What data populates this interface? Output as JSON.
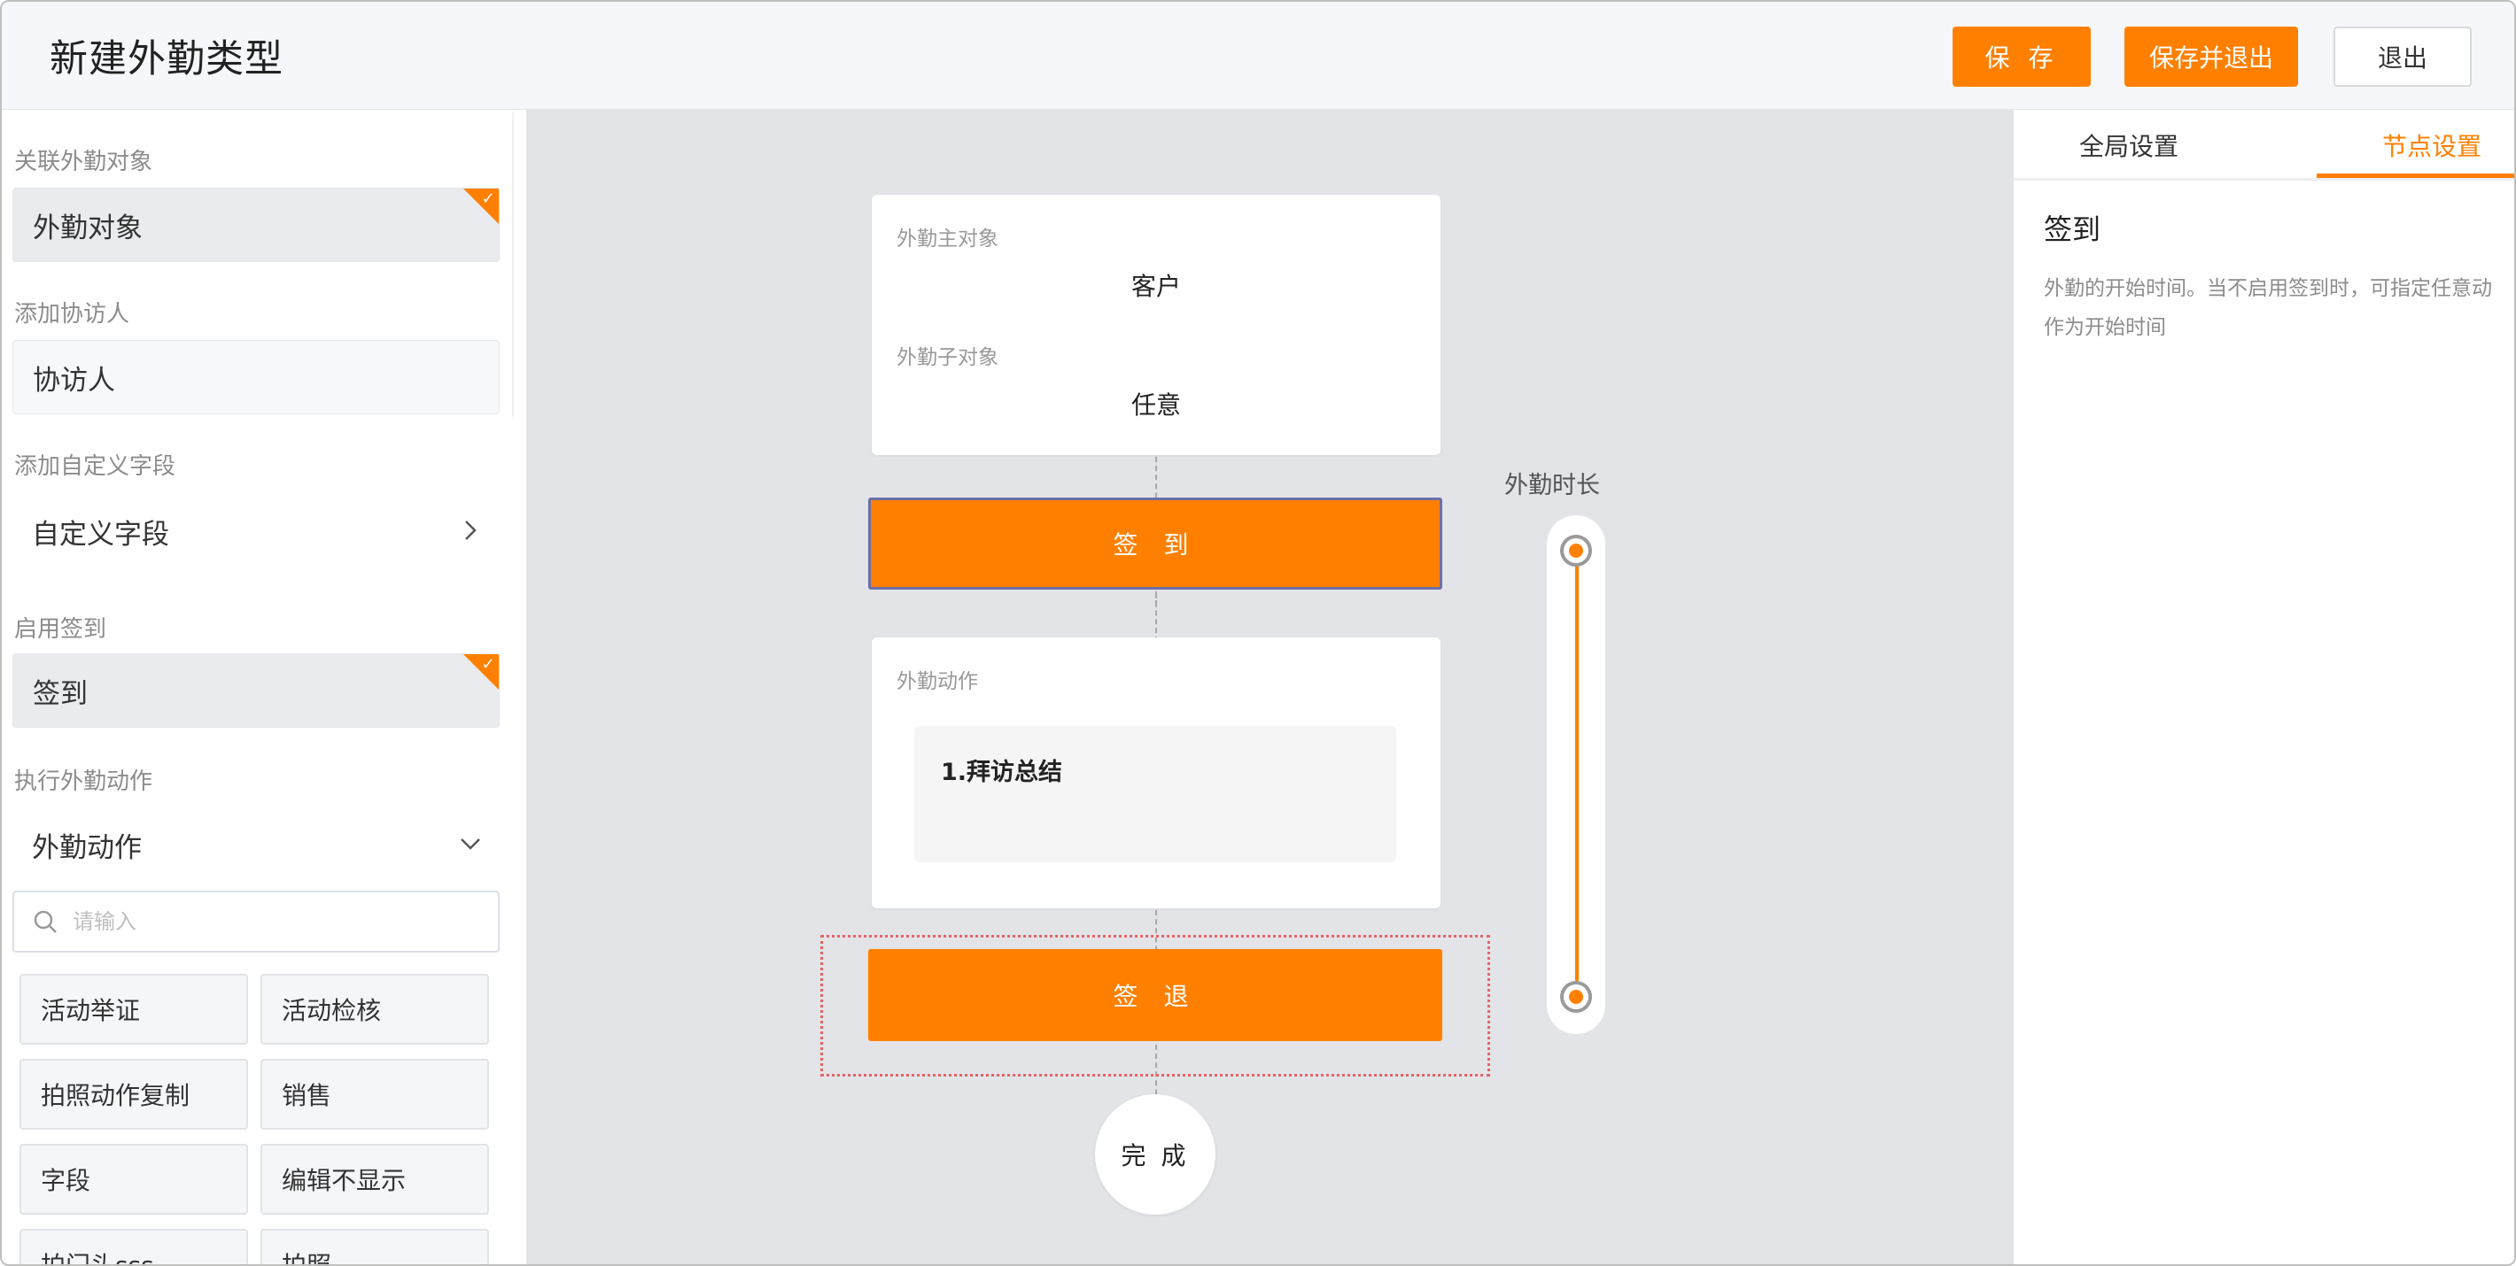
{
  "header": {
    "title": "新建外勤类型",
    "save_label": "保 存",
    "save_exit_label": "保存并退出",
    "exit_label": "退出"
  },
  "left": {
    "linked_object_label": "关联外勤对象",
    "linked_object_value": "外勤对象",
    "add_companion_label": "添加协访人",
    "add_companion_value": "协访人",
    "add_custom_field_label": "添加自定义字段",
    "custom_field_value": "自定义字段",
    "enable_checkin_label": "启用签到",
    "checkin_value": "签到",
    "execute_action_label": "执行外勤动作",
    "action_value": "外勤动作",
    "search_placeholder": "请输入",
    "actions": [
      "活动举证",
      "活动检核",
      "拍照动作复制",
      "销售",
      "字段",
      "编辑不显示",
      "拍门头sss",
      "拍照"
    ]
  },
  "canvas": {
    "main_object_label": "外勤主对象",
    "main_object_value": "客户",
    "sub_object_label": "外勤子对象",
    "sub_object_value": "任意",
    "checkin_node": "签 到",
    "action_card_label": "外勤动作",
    "action_item": "1.拜访总结",
    "checkout_node": "签 退",
    "finish_node": "完 成",
    "duration_label": "外勤时长"
  },
  "right": {
    "tab_global": "全局设置",
    "tab_node": "节点设置",
    "node_title": "签到",
    "node_desc": "外勤的开始时间。当不启用签到时，可指定任意动作为开始时间"
  },
  "colors": {
    "accent": "#ff8000",
    "canvas_bg": "#e3e4e8",
    "selected_outline": "#e86363"
  }
}
